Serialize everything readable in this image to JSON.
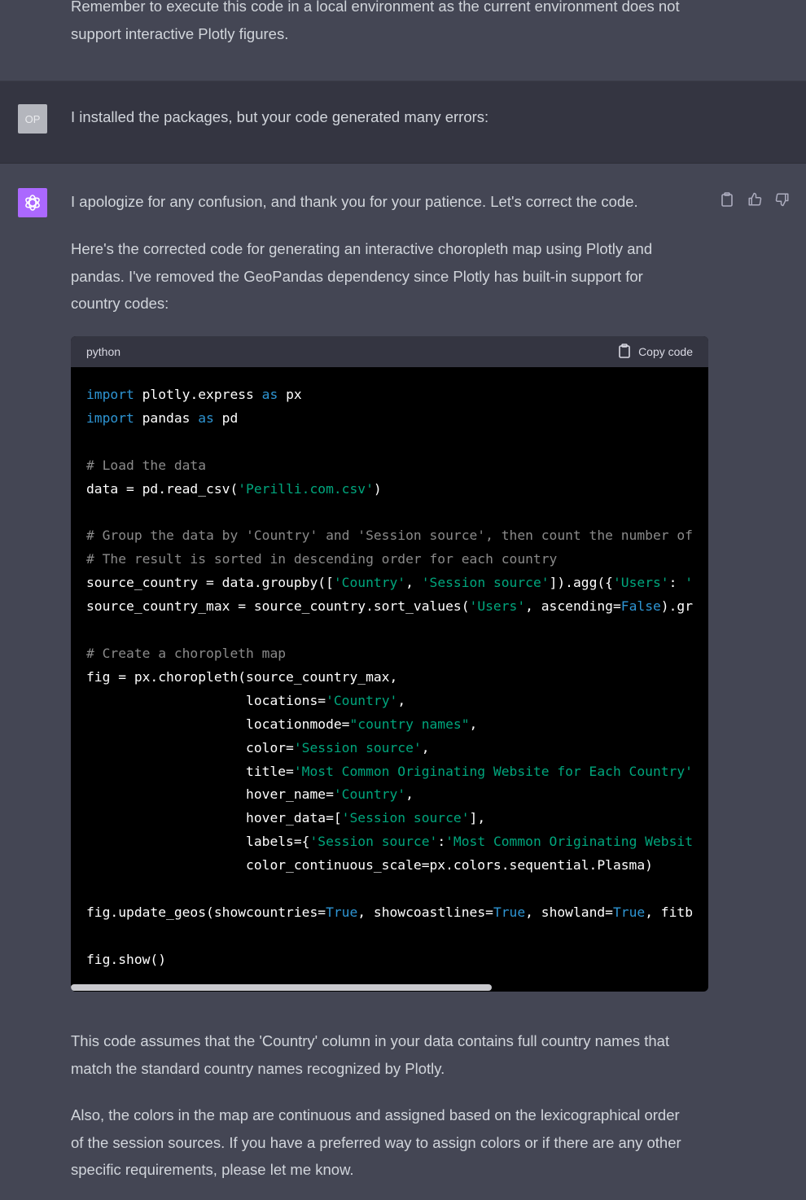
{
  "previous": {
    "lines": [
      "Remember to execute this code in a local environment as the current environment does not",
      "support interactive Plotly figures."
    ]
  },
  "user": {
    "avatar_initials": "OP",
    "message": "I installed the packages, but your code generated many errors:"
  },
  "assistant": {
    "avatar_icon": "openai-logo-icon",
    "actions": [
      "clipboard-icon",
      "thumbs-up-icon",
      "thumbs-down-icon"
    ],
    "p1": "I apologize for any confusion, and thank you for your patience. Let's correct the code.",
    "p2_lines": [
      "Here's the corrected code for generating an interactive choropleth map using Plotly and",
      "pandas. I've removed the GeoPandas dependency since Plotly has built-in support for",
      "country codes:"
    ],
    "code": {
      "language": "python",
      "copy_label": "Copy code",
      "lines": [
        [
          [
            "kw",
            "import"
          ],
          [
            "t",
            " plotly.express "
          ],
          [
            "kw",
            "as"
          ],
          [
            "t",
            " px"
          ]
        ],
        [
          [
            "kw",
            "import"
          ],
          [
            "t",
            " pandas "
          ],
          [
            "kw",
            "as"
          ],
          [
            "t",
            " pd"
          ]
        ],
        [],
        [
          [
            "com",
            "# Load the data"
          ]
        ],
        [
          [
            "t",
            "data = pd.read_csv("
          ],
          [
            "str",
            "'Perilli.com.csv'"
          ],
          [
            "t",
            ")"
          ]
        ],
        [],
        [
          [
            "com",
            "# Group the data by 'Country' and 'Session source', then count the number of"
          ]
        ],
        [
          [
            "com",
            "# The result is sorted in descending order for each country"
          ]
        ],
        [
          [
            "t",
            "source_country = data.groupby(["
          ],
          [
            "str",
            "'Country'"
          ],
          [
            "t",
            ", "
          ],
          [
            "str",
            "'Session source'"
          ],
          [
            "t",
            "]).agg({"
          ],
          [
            "str",
            "'Users'"
          ],
          [
            "t",
            ": "
          ],
          [
            "str",
            "'"
          ]
        ],
        [
          [
            "t",
            "source_country_max = source_country.sort_values("
          ],
          [
            "str",
            "'Users'"
          ],
          [
            "t",
            ", ascending="
          ],
          [
            "bool",
            "False"
          ],
          [
            "t",
            ").gr"
          ]
        ],
        [],
        [
          [
            "com",
            "# Create a choropleth map"
          ]
        ],
        [
          [
            "t",
            "fig = px.choropleth(source_country_max,"
          ]
        ],
        [
          [
            "t",
            "                    locations="
          ],
          [
            "str",
            "'Country'"
          ],
          [
            "t",
            ","
          ]
        ],
        [
          [
            "t",
            "                    locationmode="
          ],
          [
            "str",
            "\"country names\""
          ],
          [
            "t",
            ","
          ]
        ],
        [
          [
            "t",
            "                    color="
          ],
          [
            "str",
            "'Session source'"
          ],
          [
            "t",
            ","
          ]
        ],
        [
          [
            "t",
            "                    title="
          ],
          [
            "str",
            "'Most Common Originating Website for Each Country'"
          ]
        ],
        [
          [
            "t",
            "                    hover_name="
          ],
          [
            "str",
            "'Country'"
          ],
          [
            "t",
            ","
          ]
        ],
        [
          [
            "t",
            "                    hover_data=["
          ],
          [
            "str",
            "'Session source'"
          ],
          [
            "t",
            "],"
          ]
        ],
        [
          [
            "t",
            "                    labels={"
          ],
          [
            "str",
            "'Session source'"
          ],
          [
            "t",
            ":"
          ],
          [
            "str",
            "'Most Common Originating Websit"
          ]
        ],
        [
          [
            "t",
            "                    color_continuous_scale=px.colors.sequential.Plasma)"
          ]
        ],
        [],
        [
          [
            "t",
            "fig.update_geos(showcountries="
          ],
          [
            "bool",
            "True"
          ],
          [
            "t",
            ", showcoastlines="
          ],
          [
            "bool",
            "True"
          ],
          [
            "t",
            ", showland="
          ],
          [
            "bool",
            "True"
          ],
          [
            "t",
            ", fitb"
          ]
        ],
        [],
        [
          [
            "t",
            "fig.show()"
          ]
        ]
      ]
    },
    "p3_lines": [
      "This code assumes that the 'Country' column in your data contains full country names that",
      "match the standard country names recognized by Plotly."
    ],
    "p4_lines": [
      "Also, the colors in the map are continuous and assigned based on the lexicographical order",
      "of the session sources. If you have a preferred way to assign colors or if there are any other",
      "specific requirements, please let me know."
    ]
  }
}
